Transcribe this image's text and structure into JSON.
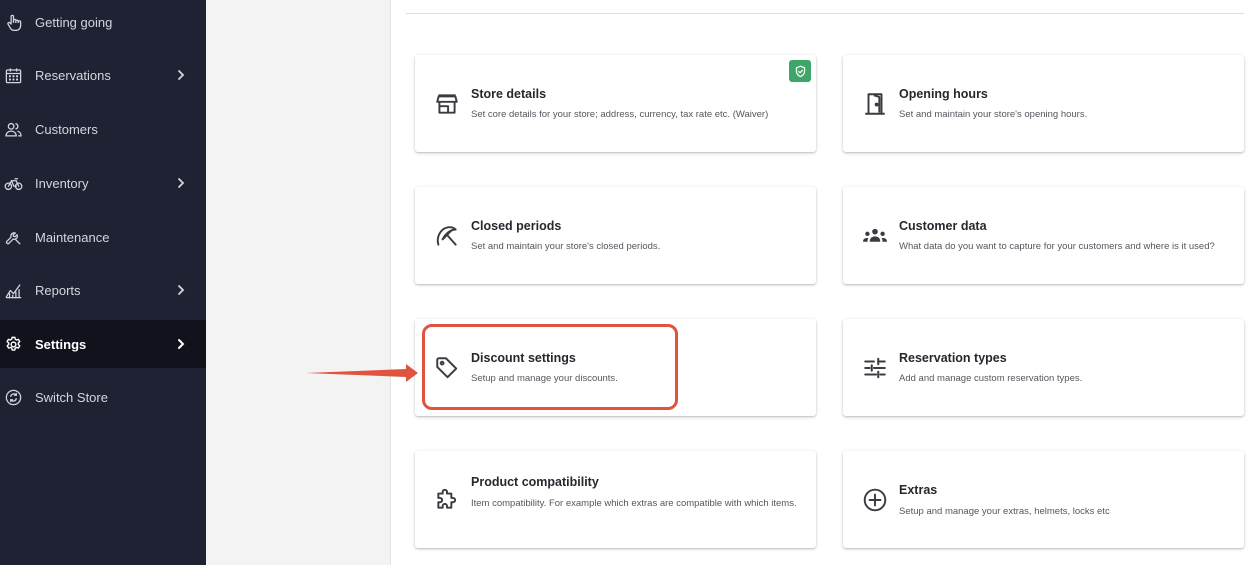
{
  "sidebar": {
    "items": [
      {
        "label": "Getting going",
        "icon": "hand-pointer-icon",
        "has_chevron": false
      },
      {
        "label": "Reservations",
        "icon": "calendar-icon",
        "has_chevron": true
      },
      {
        "label": "Customers",
        "icon": "users-icon",
        "has_chevron": false
      },
      {
        "label": "Inventory",
        "icon": "bicycle-icon",
        "has_chevron": true
      },
      {
        "label": "Maintenance",
        "icon": "wrench-icon",
        "has_chevron": false
      },
      {
        "label": "Reports",
        "icon": "chart-icon",
        "has_chevron": true
      },
      {
        "label": "Settings",
        "icon": "gear-icon",
        "has_chevron": true,
        "active": true
      },
      {
        "label": "Switch Store",
        "icon": "switch-icon",
        "has_chevron": false
      }
    ]
  },
  "cards": [
    {
      "title": "Store details",
      "desc": "Set core details for your store; address, currency, tax rate etc. (Waiver)",
      "icon": "store-icon",
      "badge": "shield-check-icon"
    },
    {
      "title": "Opening hours",
      "desc": "Set and maintain your store's opening hours.",
      "icon": "door-icon"
    },
    {
      "title": "Closed periods",
      "desc": "Set and maintain your store's closed periods.",
      "icon": "beach-umbrella-off-icon"
    },
    {
      "title": "Customer data",
      "desc": "What data do you want to capture for your customers and where is it used?",
      "icon": "groups-icon"
    },
    {
      "title": "Discount settings",
      "desc": "Setup and manage your discounts.",
      "icon": "tag-icon"
    },
    {
      "title": "Reservation types",
      "desc": "Add and manage custom reservation types.",
      "icon": "sliders-icon"
    },
    {
      "title": "Product compatibility",
      "desc": "Item compatibility. For example which extras are compatible with which items.",
      "icon": "puzzle-icon"
    },
    {
      "title": "Extras",
      "desc": "Setup and manage your extras, helmets, locks etc",
      "icon": "plus-circle-icon"
    }
  ],
  "colors": {
    "sidebar_bg": "#1f2233",
    "sidebar_active_bg": "#11131c",
    "badge_green": "#3fa66a",
    "annotation_red": "#e0533f"
  }
}
